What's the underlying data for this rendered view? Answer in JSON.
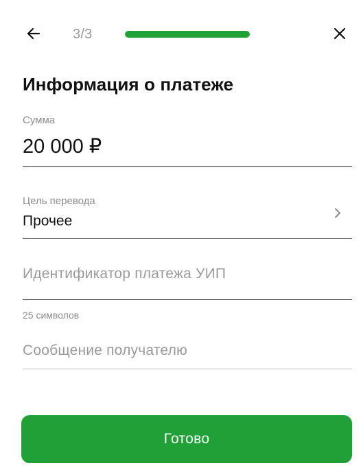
{
  "header": {
    "step": "3/3",
    "progress_fraction": 1.0,
    "back_icon": "arrow-left-icon",
    "close_icon": "close-icon"
  },
  "page": {
    "title": "Информация о платеже"
  },
  "fields": {
    "amount": {
      "label": "Сумма",
      "value": "20 000 ₽"
    },
    "purpose": {
      "label": "Цель перевода",
      "value": "Прочее",
      "icon": "chevron-right-icon"
    },
    "uip": {
      "placeholder": "Идентификатор платежа УИП",
      "hint": "25 символов"
    },
    "message": {
      "placeholder": "Сообщение получателю"
    }
  },
  "actions": {
    "done_label": "Готово"
  },
  "colors": {
    "accent": "#21a038",
    "progress_track": "#e4e4e4",
    "muted_text": "#9a9a9a"
  }
}
